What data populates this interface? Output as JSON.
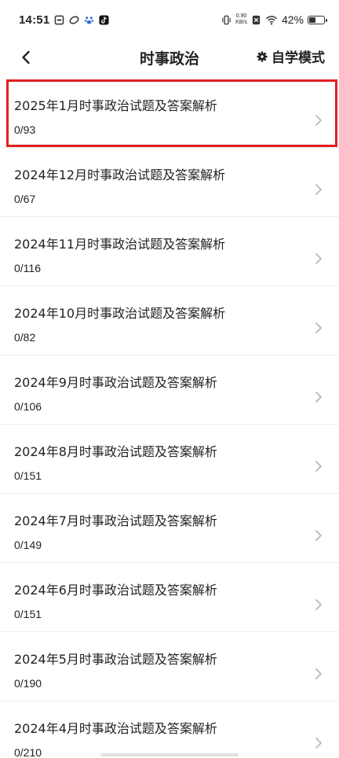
{
  "status_bar": {
    "time": "14:51",
    "net_speed_value": "0.90",
    "net_speed_unit": "KB/s",
    "battery_percent": "42%",
    "battery_level": 0.42
  },
  "header": {
    "title": "时事政治",
    "mode_label": "自学模式"
  },
  "items": [
    {
      "title": "2025年1月时事政治试题及答案解析",
      "progress": "0/93"
    },
    {
      "title": "2024年12月时事政治试题及答案解析",
      "progress": "0/67"
    },
    {
      "title": "2024年11月时事政治试题及答案解析",
      "progress": "0/116"
    },
    {
      "title": "2024年10月时事政治试题及答案解析",
      "progress": "0/82"
    },
    {
      "title": "2024年9月时事政治试题及答案解析",
      "progress": "0/106"
    },
    {
      "title": "2024年8月时事政治试题及答案解析",
      "progress": "0/151"
    },
    {
      "title": "2024年7月时事政治试题及答案解析",
      "progress": "0/149"
    },
    {
      "title": "2024年6月时事政治试题及答案解析",
      "progress": "0/151"
    },
    {
      "title": "2024年5月时事政治试题及答案解析",
      "progress": "0/190"
    },
    {
      "title": "2024年4月时事政治试题及答案解析",
      "progress": "0/210"
    }
  ],
  "colors": {
    "highlight": "#e02020",
    "divider": "#ececec",
    "chevron": "#b8b8b8"
  }
}
